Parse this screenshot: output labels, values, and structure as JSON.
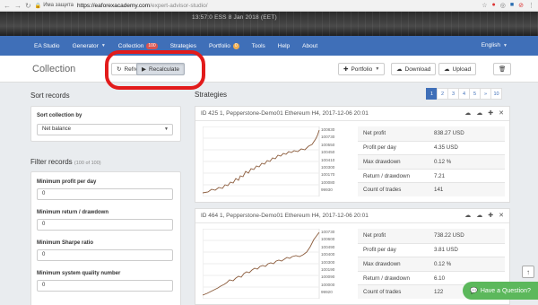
{
  "browser": {
    "security_label": "Има защита",
    "url_host": "https://eaforexacademy.com",
    "url_path": "/expert-advisor-studio/"
  },
  "banner": {
    "text": "13:57:0   ESS   8 Jan 2018 (EET)"
  },
  "nav": {
    "items": [
      {
        "label": "EA Studio"
      },
      {
        "label": "Generator"
      },
      {
        "label": "Collection",
        "badge": "100"
      },
      {
        "label": "Strategies"
      },
      {
        "label": "Portfolio",
        "badge": "0"
      },
      {
        "label": "Tools"
      },
      {
        "label": "Help"
      },
      {
        "label": "About"
      }
    ],
    "language": "English"
  },
  "toolbar": {
    "title": "Collection",
    "refresh_label": "Refresh",
    "recalculate_label": "Recalculate",
    "portfolio_label": "Portfolio",
    "download_label": "Download",
    "upload_label": "Upload"
  },
  "sort": {
    "title": "Sort records",
    "label": "Sort collection by",
    "value": "Net balance"
  },
  "filter": {
    "title": "Filter records",
    "count": "(100 of 100)",
    "fields": [
      {
        "label": "Minimum profit per day",
        "value": "0"
      },
      {
        "label": "Minimum return / drawdown",
        "value": "0"
      },
      {
        "label": "Minimum Sharpe ratio",
        "value": "0"
      },
      {
        "label": "Minimum system quality number",
        "value": "0"
      }
    ]
  },
  "strategies": {
    "title": "Strategies",
    "pages": [
      "1",
      "2",
      "3",
      "4",
      "5",
      "»",
      "10"
    ],
    "active_page": "1",
    "cards": [
      {
        "title": "ID 425 1, Pepperstone-Demo01 Ethereum H4, 2017-12-06 20:01",
        "ticks": [
          "100830",
          "100730",
          "100550",
          "100450",
          "100410",
          "100300",
          "100170",
          "100080",
          "99930"
        ],
        "stats": [
          {
            "label": "Net profit",
            "value": "838.27 USD"
          },
          {
            "label": "Profit per day",
            "value": "4.35 USD"
          },
          {
            "label": "Max drawdown",
            "value": "0.12 %"
          },
          {
            "label": "Return / drawdown",
            "value": "7.21"
          },
          {
            "label": "Count of trades",
            "value": "141"
          }
        ]
      },
      {
        "title": "ID 464 1, Pepperstone-Demo01 Ethereum H4, 2017-12-06 20:01",
        "ticks": [
          "100730",
          "100600",
          "100490",
          "100400",
          "100300",
          "100190",
          "100090",
          "100000",
          "99920"
        ],
        "stats": [
          {
            "label": "Net profit",
            "value": "738.22 USD"
          },
          {
            "label": "Profit per day",
            "value": "3.81 USD"
          },
          {
            "label": "Max drawdown",
            "value": "0.12 %"
          },
          {
            "label": "Return / drawdown",
            "value": "6.10"
          },
          {
            "label": "Count of trades",
            "value": "122"
          }
        ]
      }
    ]
  },
  "help_button": {
    "label": "Have a Question?"
  },
  "colors": {
    "nav": "#3f6fb8",
    "highlight": "#e21b1b",
    "help": "#5cb85c"
  }
}
